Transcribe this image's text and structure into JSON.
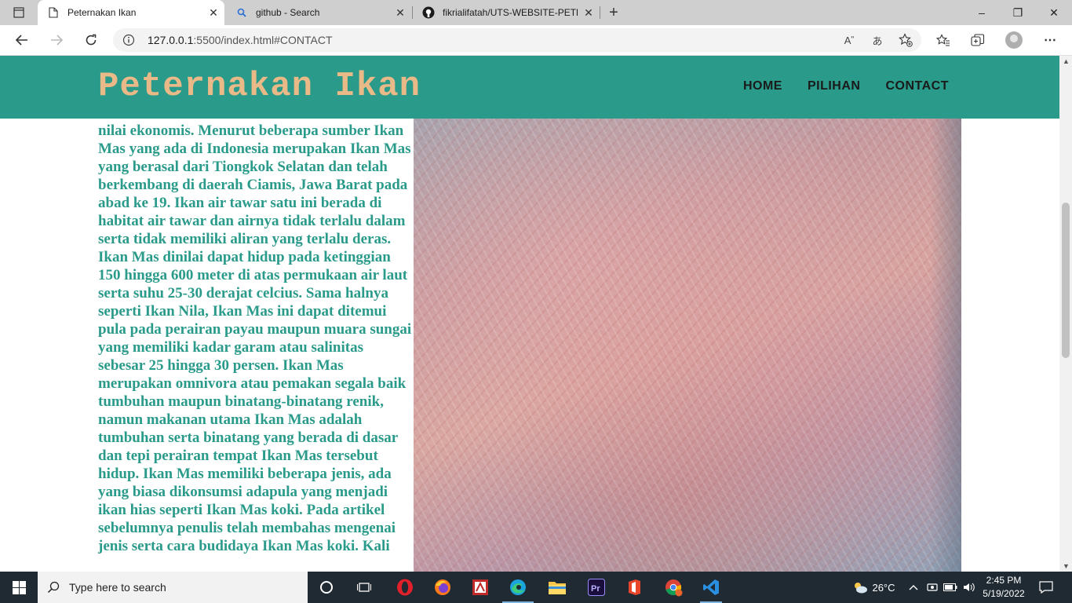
{
  "browser": {
    "tabs": [
      {
        "title": "Peternakan Ikan",
        "icon": "page-icon",
        "active": true
      },
      {
        "title": "github - Search",
        "icon": "search-icon",
        "active": false
      },
      {
        "title": "fikrialifatah/UTS-WEBSITE-PETER",
        "icon": "github-icon",
        "active": false
      }
    ],
    "url_host": "127.0.0.1",
    "url_rest": ":5500/index.html#CONTACT",
    "new_tab": "+",
    "window_controls": {
      "minimize": "–",
      "maximize": "❐",
      "close": "✕"
    }
  },
  "site": {
    "logo": "Peternakan Ikan",
    "nav": [
      "HOME",
      "PILIHAN",
      "CONTACT"
    ],
    "article": "nilai ekonomis. Menurut beberapa sumber Ikan Mas yang ada di Indonesia merupakan Ikan Mas yang berasal dari Tiongkok Selatan dan telah berkembang di daerah Ciamis, Jawa Barat pada abad ke 19. Ikan air tawar satu ini berada di habitat air tawar dan airnya tidak terlalu dalam serta tidak memiliki aliran yang terlalu deras. Ikan Mas dinilai dapat hidup pada ketinggian 150 hingga 600 meter di atas permukaan air laut serta suhu 25-30 derajat celcius. Sama halnya seperti Ikan Nila, Ikan Mas ini dapat ditemui pula pada perairan payau maupun muara sungai yang memiliki kadar garam atau salinitas sebesar 25 hingga 30 persen. Ikan Mas merupakan omnivora atau pemakan segala baik tumbuhan maupun binatang-binatang renik, namun makanan utama Ikan Mas adalah tumbuhan serta binatang yang berada di dasar dan tepi perairan tempat Ikan Mas tersebut hidup. Ikan Mas memiliki beberapa jenis, ada yang biasa dikonsumsi adapula yang menjadi ikan hias seperti Ikan Mas koki. Pada artikel sebelumnya penulis telah membahas mengenai jenis serta cara budidaya Ikan Mas koki. Kali",
    "colors": {
      "header": "#2a9a8a",
      "logo": "#e9b987",
      "text": "#2a9a8a"
    }
  },
  "taskbar": {
    "search_placeholder": "Type here to search",
    "weather": "26°C",
    "time": "2:45 PM",
    "date": "5/19/2022",
    "apps": [
      "task-view-icon",
      "opera-icon",
      "firefox-icon",
      "filezilla-icon",
      "edge-icon",
      "file-explorer-icon",
      "premiere-icon",
      "office-icon",
      "chrome-icon",
      "vscode-icon"
    ]
  }
}
